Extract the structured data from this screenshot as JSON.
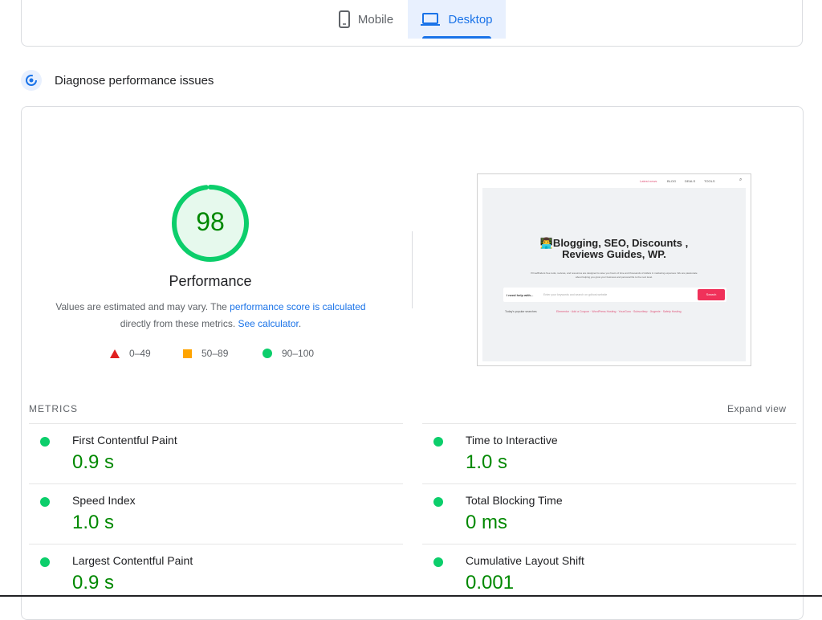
{
  "tabs": [
    {
      "label": "Mobile",
      "icon": "mobile-icon",
      "active": false
    },
    {
      "label": "Desktop",
      "icon": "desktop-icon",
      "active": true
    }
  ],
  "diagnose": {
    "title": "Diagnose performance issues",
    "icon": "gauge-icon"
  },
  "performance": {
    "score": 98,
    "score_text": "98",
    "title": "Performance",
    "desc_before": "Values are estimated and may vary. The ",
    "desc_link1": "performance score is calculated",
    "desc_middle": " directly from these metrics. ",
    "desc_link2": "See calculator",
    "desc_after": "."
  },
  "legend": [
    {
      "label": "0–49",
      "color": "#e02020",
      "shape": "triangle"
    },
    {
      "label": "50–89",
      "color": "#ffa400",
      "shape": "square"
    },
    {
      "label": "90–100",
      "color": "#0cce6b",
      "shape": "circle"
    }
  ],
  "thumbnail": {
    "nav": [
      "Latest news",
      "BLOG",
      "DEALS",
      "TOOLS"
    ],
    "heading_line1": "👨‍💻Blogging, SEO, Discounts ,",
    "heading_line2": "Reviews Guides, WP.",
    "paragraph": "PrimeBinders free tools, reviews, and resources are designed to save you hours of time and thousands of dollars in marketing expenses. We are passionate about helping you grow your business and personal life to the next level.",
    "search_label": "I need help with...",
    "search_placeholder": "Enter your keywords and search on gdhost.website",
    "search_button": "Search",
    "popular_label": "Today's popular searches",
    "popular_links": "Elementor · Add a Coupon · WordPress Hosting · YouxGuru · Subscribep · Jiogenie · Safety Hosting"
  },
  "metrics": {
    "label": "METRICS",
    "expand_label": "Expand view",
    "items": [
      {
        "name": "First Contentful Paint",
        "value": "0.9 s"
      },
      {
        "name": "Time to Interactive",
        "value": "1.0 s"
      },
      {
        "name": "Speed Index",
        "value": "1.0 s"
      },
      {
        "name": "Total Blocking Time",
        "value": "0 ms"
      },
      {
        "name": "Largest Contentful Paint",
        "value": "0.9 s"
      },
      {
        "name": "Cumulative Layout Shift",
        "value": "0.001"
      }
    ]
  },
  "colors": {
    "accent": "#1a73e8",
    "pass": "#0cce6b",
    "pass_text": "#008800"
  }
}
